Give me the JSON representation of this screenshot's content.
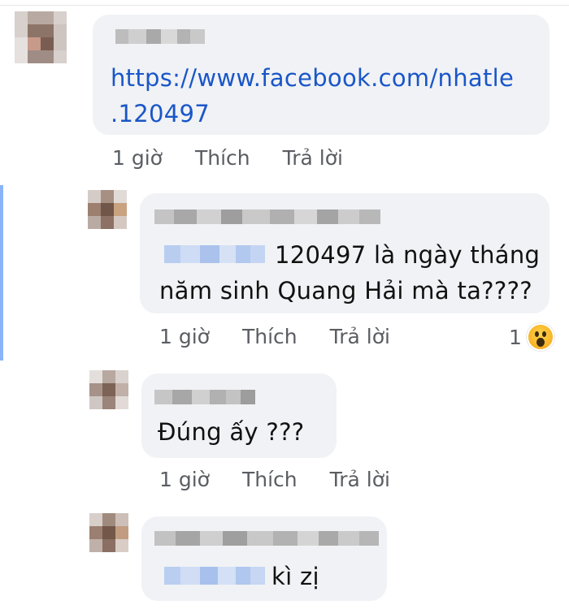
{
  "comments": [
    {
      "id": "c1",
      "link_line1": "https://www.facebook.com/nhatle",
      "link_line2": ".120497",
      "time": "1 giờ",
      "like": "Thích",
      "reply": "Trả lời"
    },
    {
      "id": "c2",
      "text_line1": "120497 là ngày tháng",
      "text_line2": "năm sinh Quang Hải mà ta????",
      "time": "1 giờ",
      "like": "Thích",
      "reply": "Trả lời",
      "reaction_count": "1",
      "reaction_icon": "wow-reaction-icon"
    },
    {
      "id": "c3",
      "text_line1": "Đúng ấy ???",
      "time": "1 giờ",
      "like": "Thích",
      "reply": "Trả lời"
    },
    {
      "id": "c4",
      "text_line1": "kì zị"
    }
  ],
  "colors": {
    "bubble": "#f0f2f5",
    "link": "#1a56c8",
    "thread_bar": "#8ab4f8",
    "meta_text": "#5a5d62"
  }
}
